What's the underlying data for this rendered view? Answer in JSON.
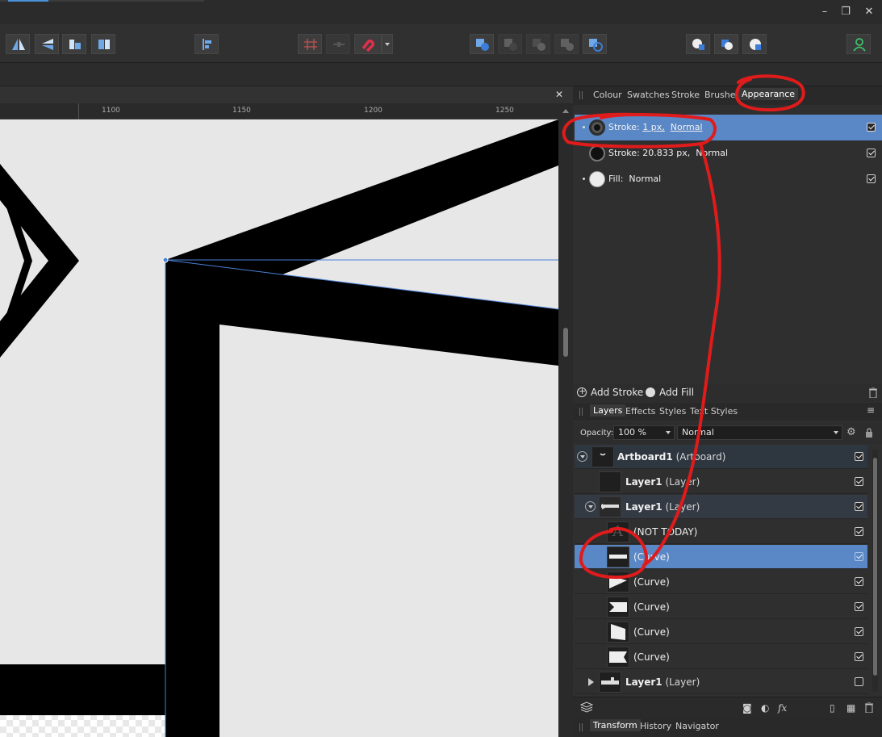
{
  "window": {
    "minimize_glyph": "–",
    "restore_glyph": "❐",
    "close_glyph": "✕"
  },
  "toolbar": {
    "icons": [
      "flip-horizontal-icon",
      "flip-vertical-icon",
      "rotate-left-icon",
      "rotate-right-icon",
      "align-left-icon",
      "snap-grid-icon",
      "snap-pixel-icon",
      "snapping-magnet-icon",
      "add-shape-icon",
      "subtract-shape-icon",
      "intersect-shape-icon",
      "xor-shape-icon",
      "divide-shape-icon",
      "insert-behind-icon",
      "insert-top-icon",
      "insert-inside-icon",
      "user-icon"
    ]
  },
  "ruler": {
    "ticks": [
      "1100",
      "1150",
      "1200",
      "1250"
    ]
  },
  "canvas": {
    "close_glyph": "✕"
  },
  "top_tabs": {
    "colour": "Colour",
    "swatches": "Swatches",
    "stroke": "Stroke",
    "brushes": "Brushes",
    "appearance": "Appearance"
  },
  "appearance": {
    "rows": [
      {
        "label": "Stroke:",
        "width": "1 px,",
        "blend": "Normal",
        "checked": true,
        "selected": true
      },
      {
        "label": "Stroke:",
        "width": "20.833 px,",
        "blend": "Normal",
        "checked": true,
        "selected": false
      },
      {
        "label": "Fill:",
        "width": "",
        "blend": "Normal",
        "checked": true,
        "selected": false
      }
    ],
    "add_stroke": "Add Stroke",
    "add_fill": "Add Fill"
  },
  "layers_tabs": {
    "layers": "Layers",
    "effects": "Effects",
    "styles": "Styles",
    "text_styles": "Text Styles"
  },
  "layers_controls": {
    "opacity_label": "Opacity:",
    "opacity_value": "100 %",
    "blend_mode": "Normal"
  },
  "layers": [
    {
      "name": "Artboard1",
      "type": "(Artboard)",
      "bold": true,
      "checked": true
    },
    {
      "name": "Layer1",
      "type": "(Layer)",
      "bold": true,
      "checked": true
    },
    {
      "name": "Layer1",
      "type": "(Layer)",
      "bold": true,
      "checked": true
    },
    {
      "name": "(NOT TODAY)",
      "type": "",
      "bold": false,
      "checked": true
    },
    {
      "name": "(Curve)",
      "type": "",
      "bold": false,
      "checked": true
    },
    {
      "name": "(Curve)",
      "type": "",
      "bold": false,
      "checked": true
    },
    {
      "name": "(Curve)",
      "type": "",
      "bold": false,
      "checked": true
    },
    {
      "name": "(Curve)",
      "type": "",
      "bold": false,
      "checked": true
    },
    {
      "name": "(Curve)",
      "type": "",
      "bold": false,
      "checked": true
    },
    {
      "name": "Layer1",
      "type": "(Layer)",
      "bold": true,
      "checked": false
    }
  ],
  "bottom_tabs": {
    "transform": "Transform",
    "history": "History",
    "navigator": "Navigator"
  },
  "colors": {
    "selection": "#5a87c6",
    "annotation": "#e01b1b",
    "accent": "#4a90d9"
  }
}
